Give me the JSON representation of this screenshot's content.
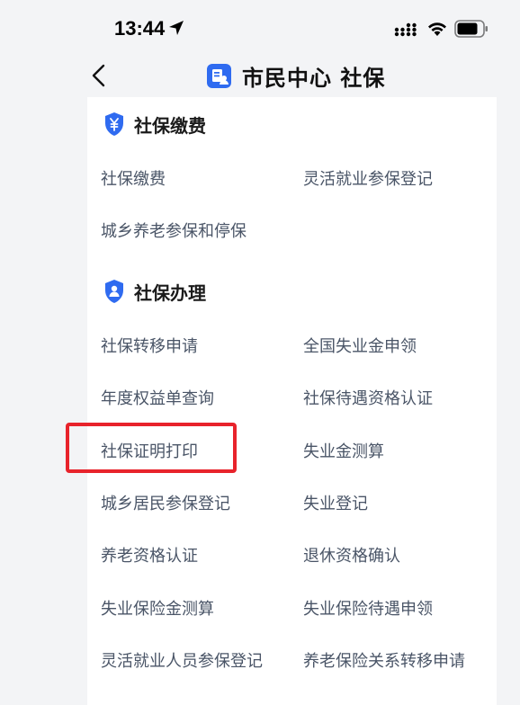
{
  "status_bar": {
    "time": "13:44"
  },
  "nav": {
    "title": "市民中心  社保"
  },
  "sections": [
    {
      "title": "社保缴费",
      "items": [
        "社保缴费",
        "灵活就业参保登记",
        "城乡养老参保和停保"
      ]
    },
    {
      "title": "社保办理",
      "items": [
        "社保转移申请",
        "全国失业金申领",
        "年度权益单查询",
        "社保待遇资格认证",
        "社保证明打印",
        "失业金测算",
        "城乡居民参保登记",
        "失业登记",
        "养老资格认证",
        "退休资格确认",
        "失业保险金测算",
        "失业保险待遇申领",
        "灵活就业人员参保登记",
        "养老保险关系转移申请"
      ]
    }
  ],
  "colors": {
    "accent": "#2f6bf0",
    "highlight": "#e8232b",
    "item_text": "#4a5567"
  }
}
